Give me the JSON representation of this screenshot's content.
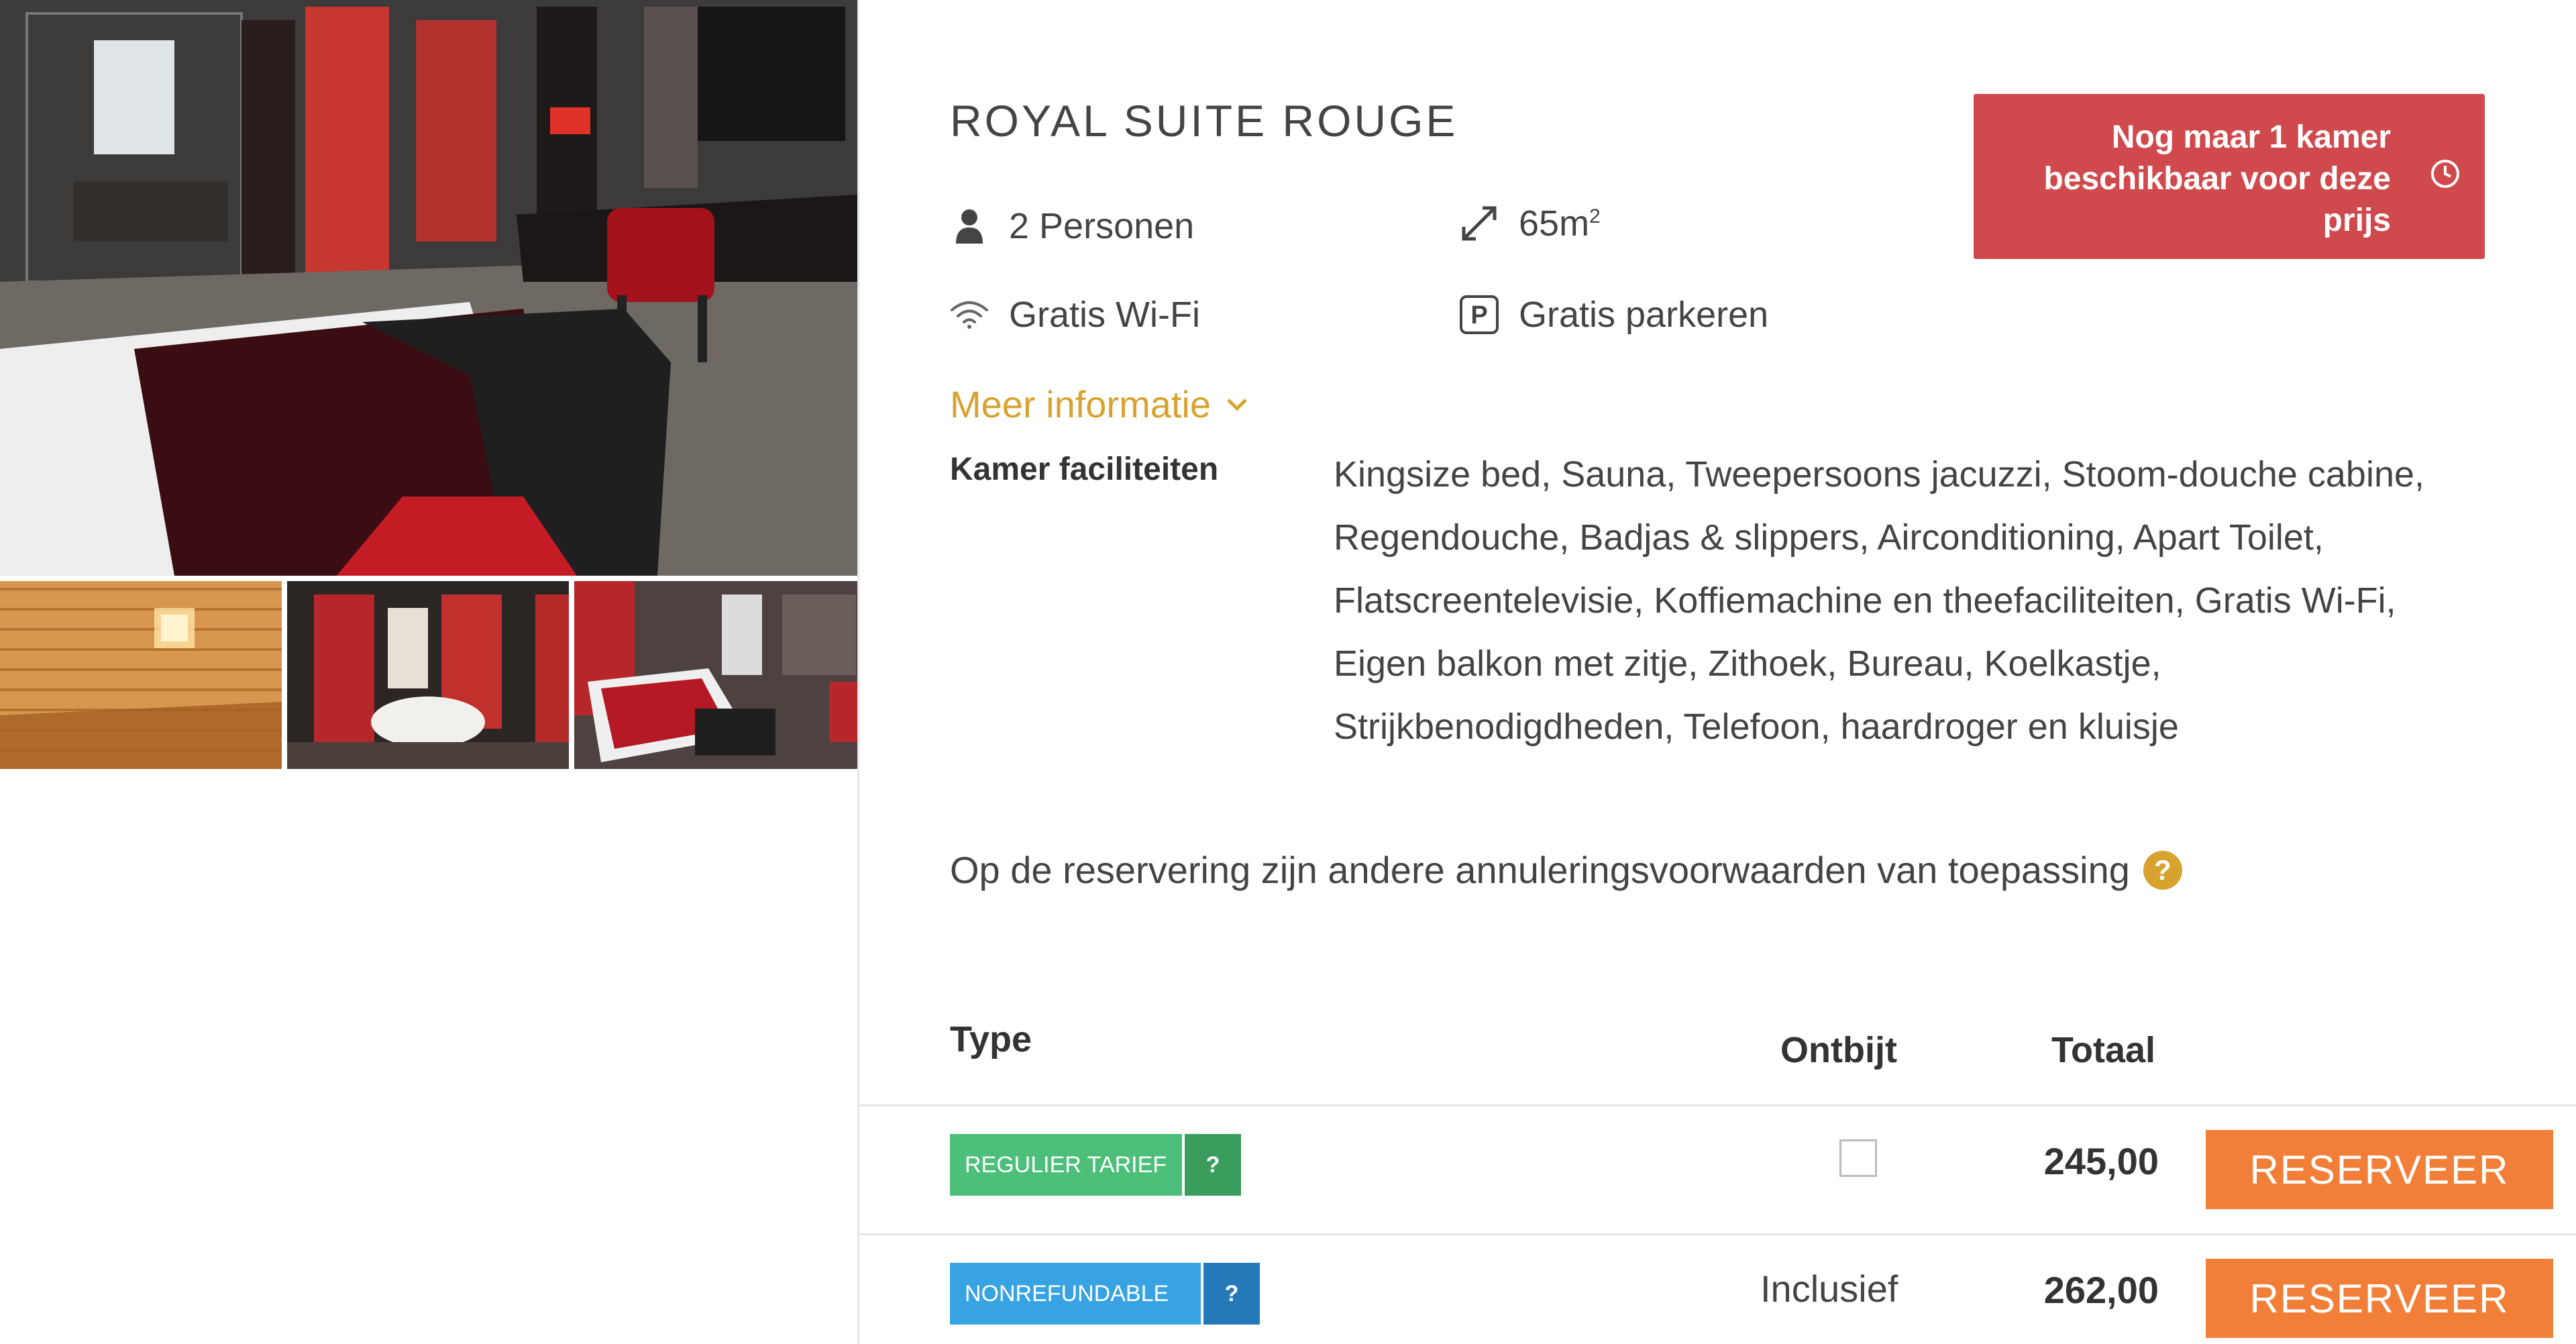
{
  "room": {
    "title": "ROYAL SUITE ROUGE",
    "persons": "2 Personen",
    "size": "65m",
    "size_sup": "2",
    "wifi": "Gratis Wi-Fi",
    "parking": "Gratis parkeren"
  },
  "alert": {
    "lines": [
      "Nog maar 1 kamer",
      "beschikbaar voor deze",
      "prijs"
    ],
    "icon": "clock-icon",
    "color": "#d04a4d"
  },
  "more_info": {
    "label": "Meer informatie",
    "icon": "chevron-down-icon",
    "color": "#d8a22e"
  },
  "facilities": {
    "label": "Kamer faciliteiten",
    "lines": [
      "Kingsize bed, Sauna, Tweepersoons jacuzzi, Stoom-douche cabine,",
      "Regendouche, Badjas & slippers, Airconditioning, Apart Toilet,",
      "Flatscreentelevisie, Koffiemachine en theefaciliteiten, Gratis Wi-Fi,",
      "Eigen balkon met zitje, Zithoek, Bureau, Koelkastje,",
      "Strijkbenodigdheden, Telefoon, haardroger en kluisje"
    ]
  },
  "cancellation": {
    "text": "Op de reservering zijn andere annuleringsvoorwaarden van toepassing",
    "help": "?"
  },
  "table": {
    "headers": {
      "type": "Type",
      "breakfast": "Ontbijt",
      "total": "Totaal"
    },
    "rows": [
      {
        "rate": "REGULIER TARIEF",
        "help": "?",
        "breakfast": "",
        "price": "245,00",
        "button": "RESERVEER",
        "color": "#4cc07a"
      },
      {
        "rate": "NONREFUNDABLE",
        "help": "?",
        "breakfast": "Inclusief",
        "price": "262,00",
        "button": "RESERVEER",
        "color": "#37a3e2"
      }
    ]
  },
  "colors": {
    "accent": "#d8a22e",
    "cta": "#f27f38",
    "alert": "#d04a4d"
  }
}
